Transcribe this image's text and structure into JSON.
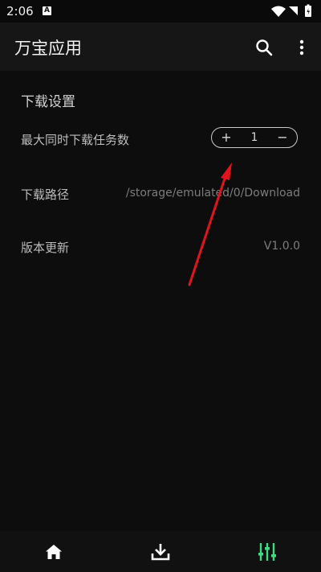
{
  "status_bar": {
    "time": "2:06",
    "notification_letter": "A"
  },
  "app_bar": {
    "title": "万宝应用",
    "search_icon": "search-icon",
    "more_icon": "more-vert-icon"
  },
  "settings": {
    "section_title": "下载设置",
    "max_downloads": {
      "label": "最大同时下载任务数",
      "value": "1",
      "plus": "+",
      "minus": "−"
    },
    "download_path": {
      "label": "下载路径",
      "value": "/storage/emulated/0/Download"
    },
    "version": {
      "label": "版本更新",
      "value": "V1.0.0"
    }
  },
  "bottom_nav": {
    "items": [
      {
        "icon": "home-icon",
        "active": false
      },
      {
        "icon": "download-icon",
        "active": false
      },
      {
        "icon": "settings-sliders-icon",
        "active": true
      }
    ]
  },
  "colors": {
    "accent": "#3ddc84",
    "annotation_arrow": "#e0141e",
    "background": "#0d0d0d"
  }
}
